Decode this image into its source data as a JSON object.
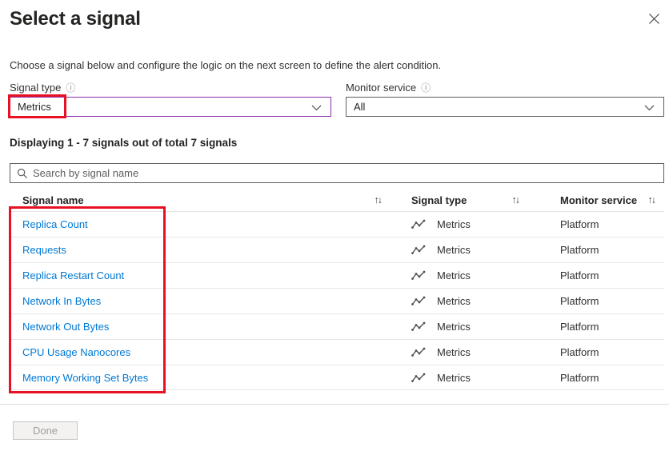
{
  "dialog": {
    "title": "Select a signal",
    "description": "Choose a signal below and configure the logic on the next screen to define the alert condition."
  },
  "filters": {
    "signal_type": {
      "label": "Signal type",
      "value": "Metrics",
      "info_icon": "ⓘ"
    },
    "monitor_service": {
      "label": "Monitor service",
      "value": "All",
      "info_icon": "ⓘ"
    }
  },
  "results_summary": "Displaying 1 - 7 signals out of total 7 signals",
  "search": {
    "placeholder": "Search by signal name"
  },
  "table": {
    "sort_icon": "↑↓",
    "columns": {
      "name": "Signal name",
      "type": "Signal type",
      "service": "Monitor service"
    },
    "rows": [
      {
        "name": "Replica Count",
        "type": "Metrics",
        "service": "Platform"
      },
      {
        "name": "Requests",
        "type": "Metrics",
        "service": "Platform"
      },
      {
        "name": "Replica Restart Count",
        "type": "Metrics",
        "service": "Platform"
      },
      {
        "name": "Network In Bytes",
        "type": "Metrics",
        "service": "Platform"
      },
      {
        "name": "Network Out Bytes",
        "type": "Metrics",
        "service": "Platform"
      },
      {
        "name": "CPU Usage Nanocores",
        "type": "Metrics",
        "service": "Platform"
      },
      {
        "name": "Memory Working Set Bytes",
        "type": "Metrics",
        "service": "Platform"
      }
    ]
  },
  "footer": {
    "done_label": "Done"
  },
  "colors": {
    "accent_purple": "#8a2da5",
    "highlight_red": "#e81123",
    "link_blue": "#0078d4"
  }
}
